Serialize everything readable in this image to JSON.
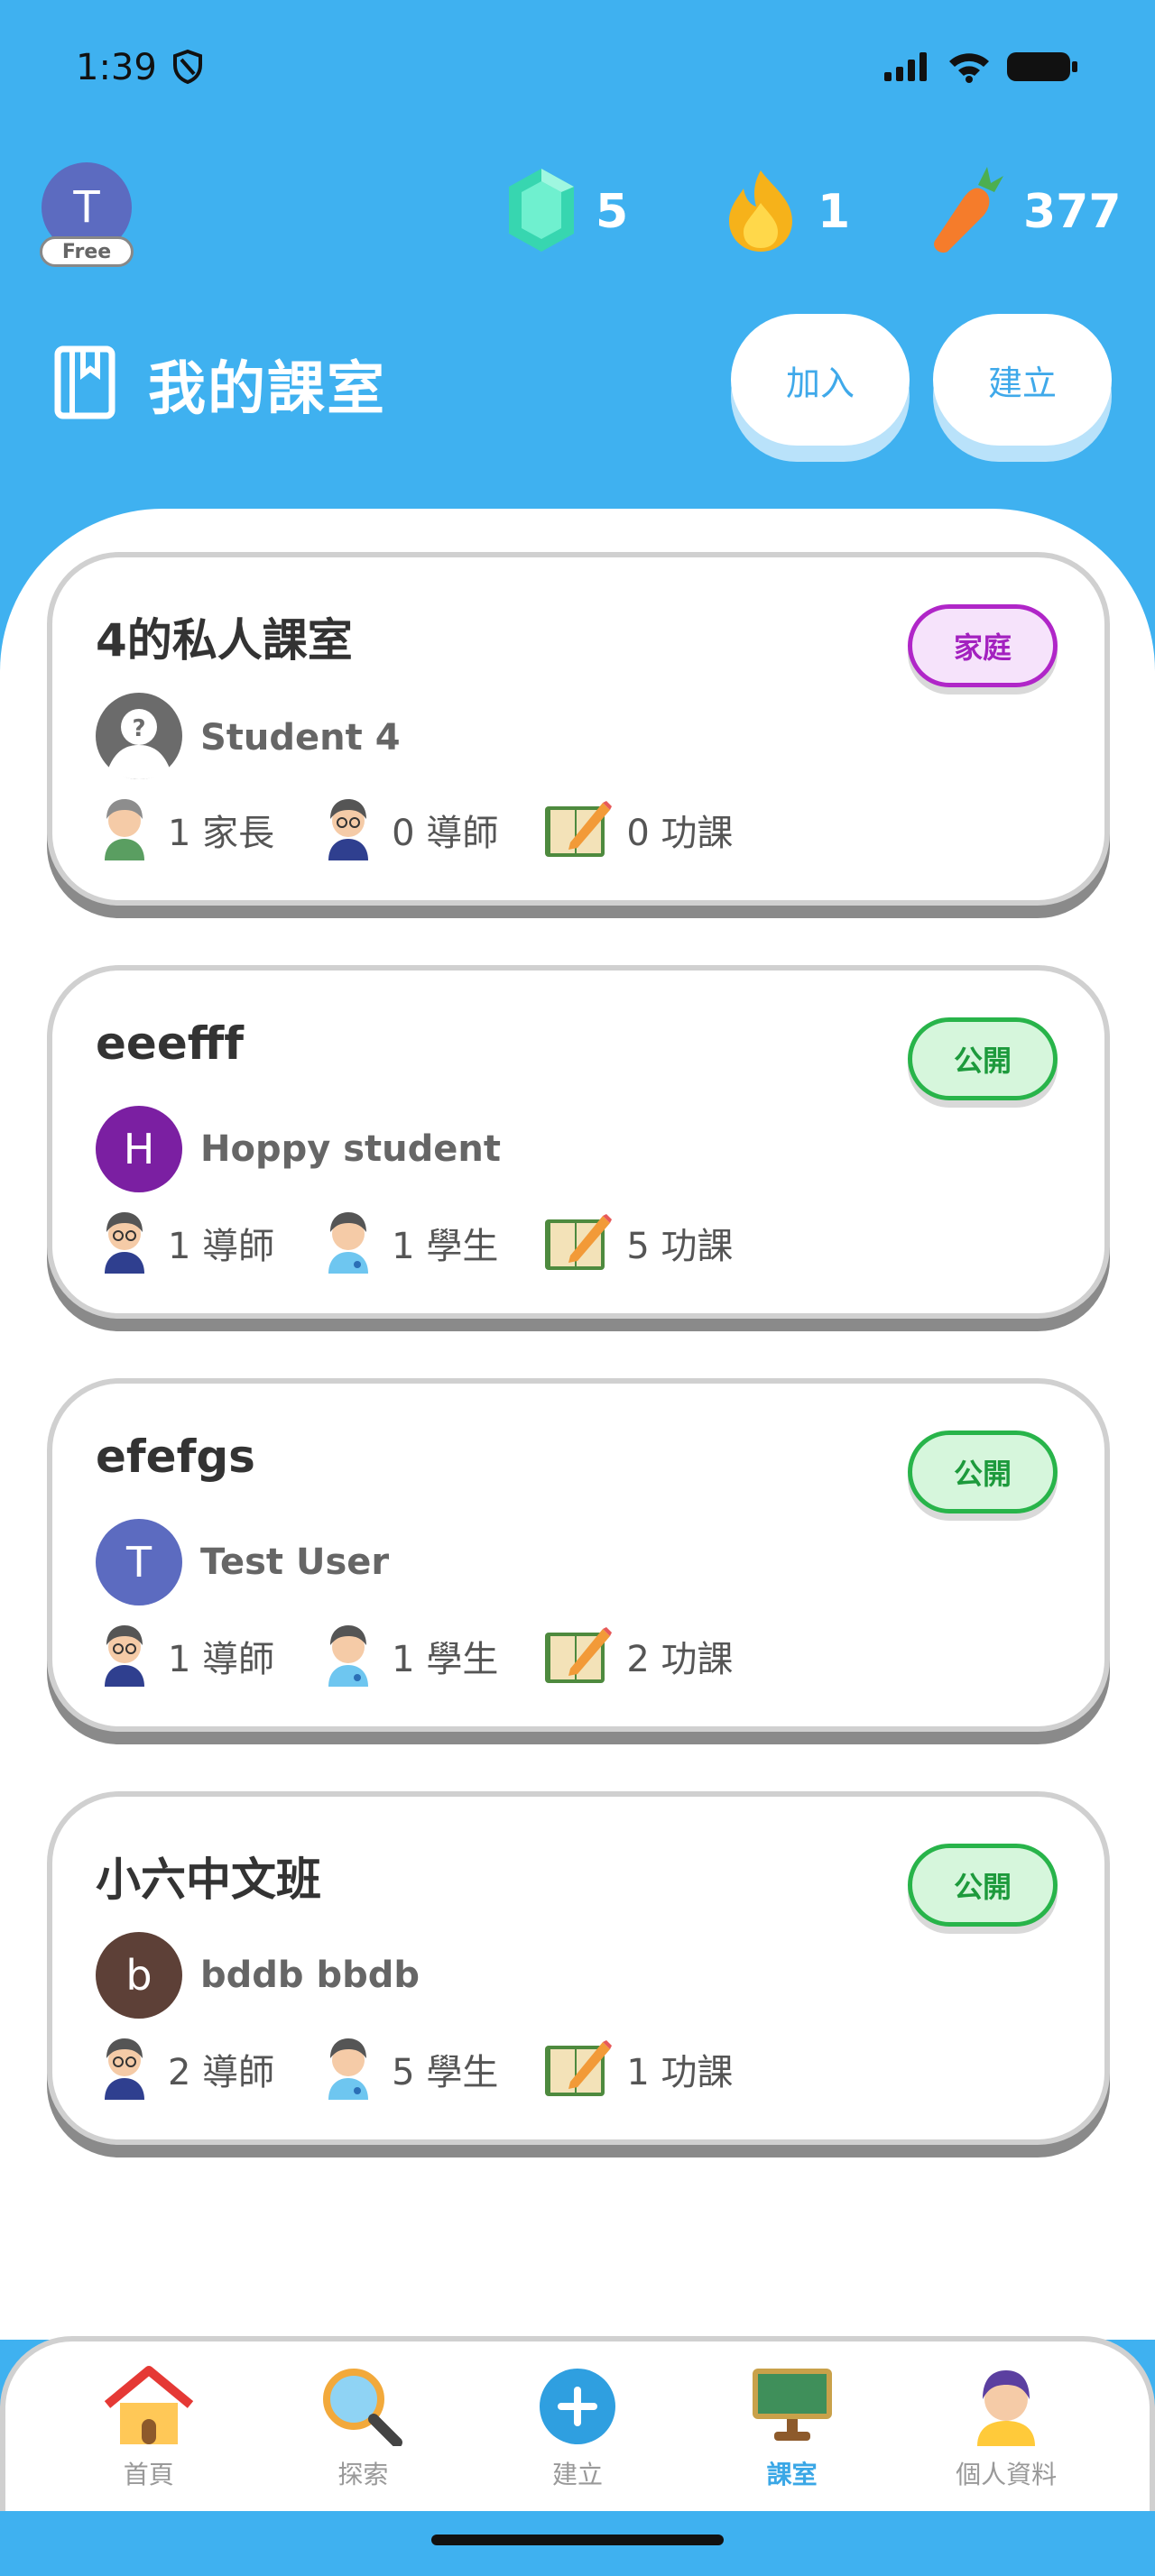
{
  "status_bar": {
    "time": "1:39"
  },
  "header": {
    "avatar_letter": "T",
    "plan_badge": "Free",
    "gems": "5",
    "streak": "1",
    "carrots": "377"
  },
  "page": {
    "title": "我的課室",
    "join_label": "加入",
    "create_label": "建立"
  },
  "classrooms": [
    {
      "name": "4的私人課室",
      "badge": "家庭",
      "owner_letter": "?",
      "owner_name": "Student 4",
      "stats": [
        "1 家長",
        "0 導師",
        "0 功課"
      ]
    },
    {
      "name": "eeefff",
      "badge": "公開",
      "owner_letter": "H",
      "owner_color": "#7b1fa2",
      "owner_name": "Hoppy student",
      "stats": [
        "1 導師",
        "1 學生",
        "5 功課"
      ]
    },
    {
      "name": "efefgs",
      "badge": "公開",
      "owner_letter": "T",
      "owner_color": "#5c6bc0",
      "owner_name": "Test User",
      "stats": [
        "1 導師",
        "1 學生",
        "2 功課"
      ]
    },
    {
      "name": "小六中文班",
      "badge": "公開",
      "owner_letter": "b",
      "owner_color": "#5d4037",
      "owner_name": "bddb bbdb",
      "stats": [
        "2 導師",
        "5 學生",
        "1 功課"
      ]
    }
  ],
  "nav": {
    "home": "首頁",
    "explore": "探索",
    "create": "建立",
    "classroom": "課室",
    "profile": "個人資料"
  },
  "colors": {
    "background": "#3fb1f0",
    "family_badge": "#b026c8",
    "public_badge": "#28b44a",
    "active_nav": "#3aa7e6"
  }
}
